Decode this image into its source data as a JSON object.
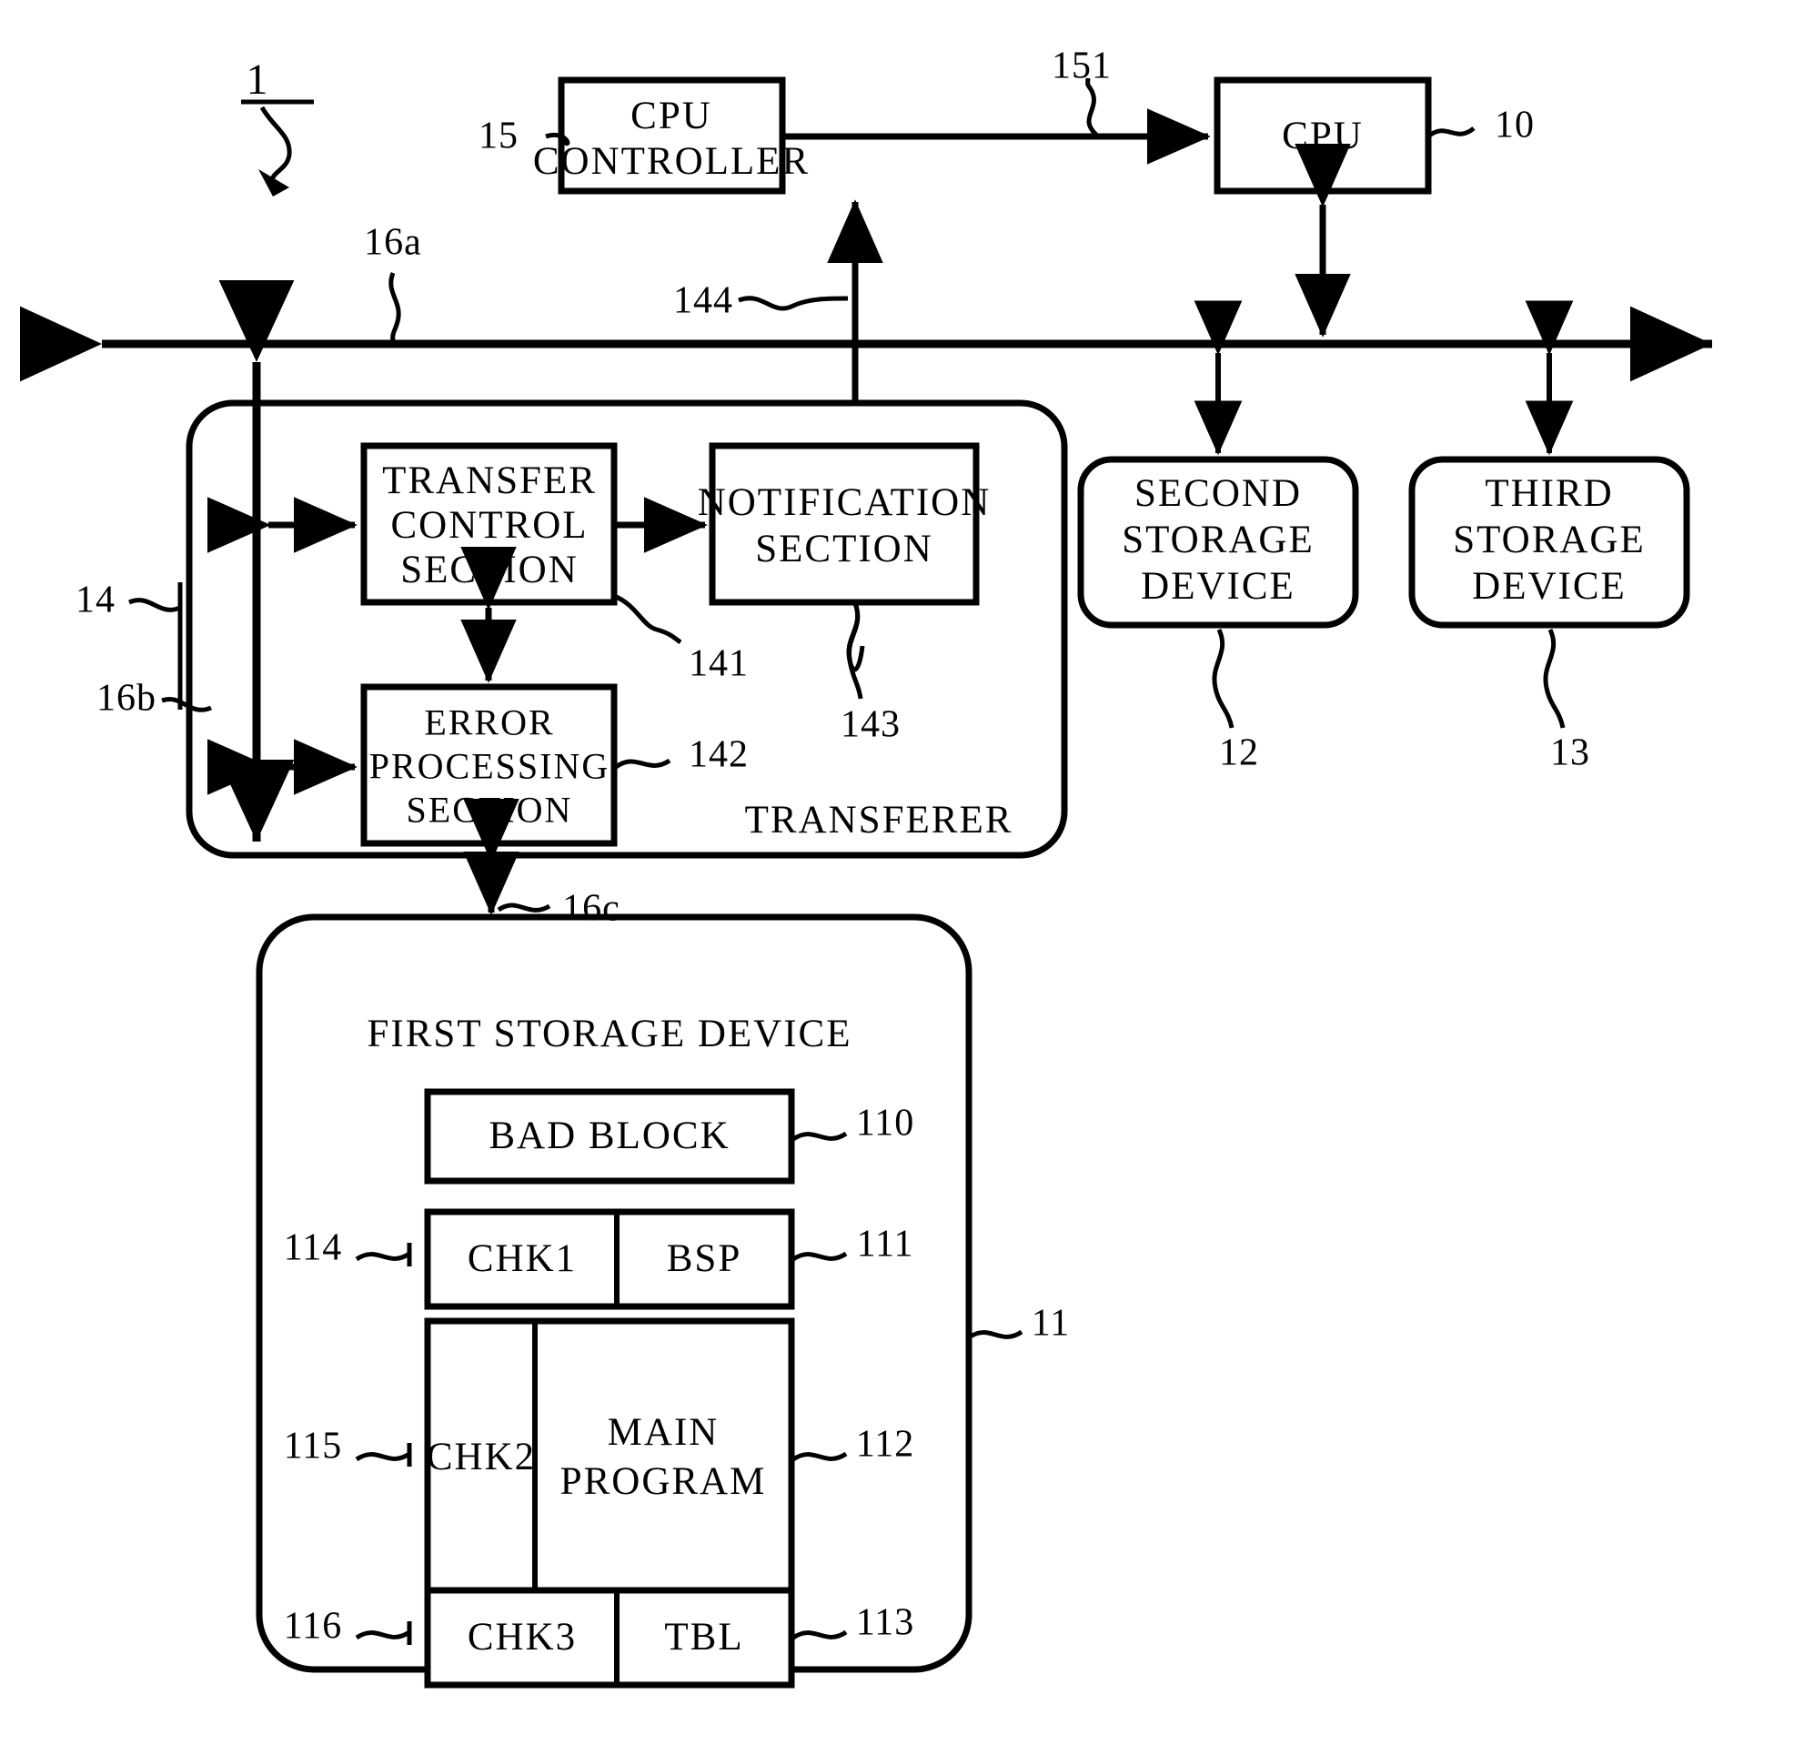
{
  "figure": {
    "system_reference": "1",
    "bus_labels": {
      "main_bus": "16a",
      "internal_bus": "16b",
      "storage_bus": "16c"
    }
  },
  "blocks": {
    "cpu_controller": {
      "label": "CPU\nCONTROLLER",
      "line1": "CPU",
      "line2": "CONTROLLER",
      "ref": "15"
    },
    "cpu": {
      "label": "CPU",
      "ref": "10"
    },
    "signal_151": {
      "ref": "151"
    },
    "signal_144": {
      "ref": "144"
    },
    "transferer": {
      "label": "TRANSFERER",
      "ref": "14",
      "children": {
        "transfer_control_section": {
          "line1": "TRANSFER",
          "line2": "CONTROL",
          "line3": "SECTION",
          "ref": "141"
        },
        "error_processing_section": {
          "line1": "ERROR",
          "line2": "PROCESSING",
          "line3": "SECTION",
          "ref": "142"
        },
        "notification_section": {
          "line1": "NOTIFICATION",
          "line2": "SECTION",
          "ref": "143"
        }
      }
    },
    "second_storage_device": {
      "line1": "SECOND",
      "line2": "STORAGE",
      "line3": "DEVICE",
      "ref": "12"
    },
    "third_storage_device": {
      "line1": "THIRD",
      "line2": "STORAGE",
      "line3": "DEVICE",
      "ref": "13"
    },
    "first_storage_device": {
      "title": "FIRST STORAGE DEVICE",
      "ref": "11",
      "rows": [
        {
          "name": "bad-block",
          "cells": [
            {
              "text": "BAD BLOCK",
              "ref_right": "110"
            }
          ]
        },
        {
          "name": "chk1-bsp",
          "ref_left": "114",
          "cells": [
            {
              "text": "CHK1"
            },
            {
              "text": "BSP",
              "ref_right": "111"
            }
          ]
        },
        {
          "name": "chk2-main-program",
          "ref_left": "115",
          "cells": [
            {
              "text": "CHK2"
            },
            {
              "text": "MAIN\nPROGRAM",
              "line1": "MAIN",
              "line2": "PROGRAM",
              "ref_right": "112"
            }
          ]
        },
        {
          "name": "chk3-tbl",
          "ref_left": "116",
          "cells": [
            {
              "text": "CHK3"
            },
            {
              "text": "TBL",
              "ref_right": "113"
            }
          ]
        }
      ]
    }
  },
  "colors": {
    "stroke": "#000000",
    "background": "#ffffff"
  }
}
